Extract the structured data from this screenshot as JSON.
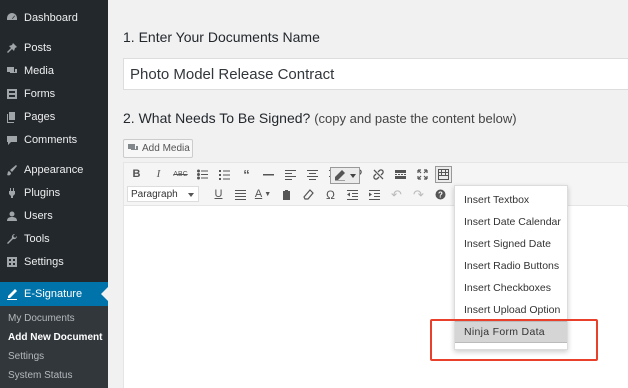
{
  "sidebar": {
    "items": [
      {
        "label": "Dashboard",
        "icon": "dashboard-icon"
      },
      {
        "label": "Posts",
        "icon": "pin-icon"
      },
      {
        "label": "Media",
        "icon": "media-icon"
      },
      {
        "label": "Forms",
        "icon": "forms-icon"
      },
      {
        "label": "Pages",
        "icon": "pages-icon"
      },
      {
        "label": "Comments",
        "icon": "comments-icon"
      },
      {
        "label": "Appearance",
        "icon": "brush-icon"
      },
      {
        "label": "Plugins",
        "icon": "plugin-icon"
      },
      {
        "label": "Users",
        "icon": "user-icon"
      },
      {
        "label": "Tools",
        "icon": "wrench-icon"
      },
      {
        "label": "Settings",
        "icon": "settings-icon"
      },
      {
        "label": "E-Signature",
        "icon": "pen-icon"
      }
    ],
    "submenu": [
      "My Documents",
      "Add New Document",
      "Settings",
      "System Status"
    ],
    "active_color": "#0073aa"
  },
  "main": {
    "step1": "1. Enter Your Documents Name",
    "doc_name": "Photo Model Release Contract",
    "step2": "2. What Needs To Be Signed?",
    "step2_note": "(copy and paste the content below)",
    "add_media": "Add Media",
    "format_select": "Paragraph"
  },
  "dropdown": {
    "items": [
      "Insert Textbox",
      "Insert Date Calendar",
      "Insert Signed Date",
      "Insert Radio Buttons",
      "Insert Checkboxes",
      "Insert Upload Option",
      "Ninja Form Data"
    ],
    "highlight_color": "#e8402b"
  }
}
